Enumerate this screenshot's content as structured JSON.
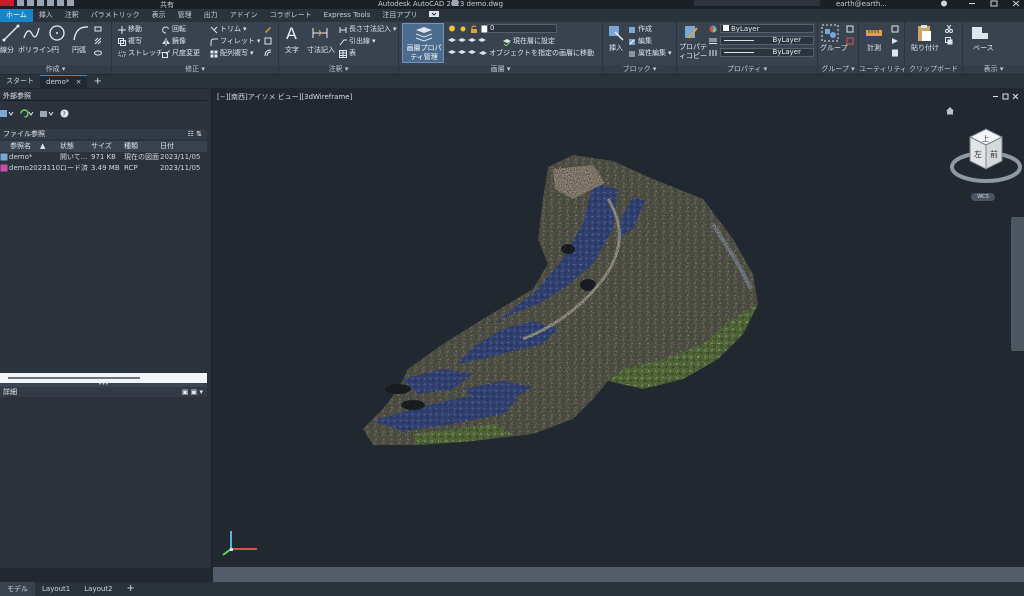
{
  "titlebar": {
    "title": "Autodesk AutoCAD 2023    demo.dwg",
    "share": "共有",
    "user": "earth@earth..."
  },
  "ribbon_tabs": [
    "ホーム",
    "挿入",
    "注釈",
    "パラメトリック",
    "表示",
    "管理",
    "出力",
    "アドイン",
    "コラボレート",
    "Express Tools",
    "注目アプリ"
  ],
  "panels": {
    "draw": {
      "title": "作成 ▾",
      "line": "線分",
      "polyline": "ポリライン",
      "circle": "円",
      "arc": "円弧"
    },
    "modify": {
      "title": "修正 ▾",
      "move": "移動",
      "rotate": "回転",
      "trim": "トリム",
      "copy": "複写",
      "mirror": "鏡像",
      "fillet": "フィレット",
      "stretch": "ストレッチ",
      "scale": "尺度変更",
      "array": "配列複写"
    },
    "annotation": {
      "title": "注釈 ▾",
      "text": "文字",
      "dimension": "寸法記入",
      "linear": "長さ寸法記入",
      "leader": "引出線",
      "table": "表"
    },
    "layers": {
      "title": "画層 ▾",
      "properties": "画層プロパティ管理",
      "layer_value": "0",
      "set_current": "現在層に設定",
      "match_layer": "オブジェクトを指定の画層に移動"
    },
    "block": {
      "title": "ブロック ▾",
      "insert": "挿入",
      "create": "作成",
      "edit": "編集",
      "attr_edit": "属性編集"
    },
    "properties": {
      "title": "プロパティ ▾",
      "match": "プロパティコピー",
      "color": "ByLayer",
      "linetype": "ByLayer",
      "lineweight": "ByLayer"
    },
    "groups": {
      "title": "グループ ▾",
      "group": "グループ"
    },
    "utilities": {
      "title": "ユーティリティ ▾",
      "measure": "計測"
    },
    "clipboard": {
      "title": "クリップボード",
      "paste": "貼り付け"
    },
    "view": {
      "title": "表示 ▾",
      "base": "ベース"
    }
  },
  "doc_tabs": [
    "スタート",
    "demo*"
  ],
  "palette": {
    "title": "外部参照",
    "file_refs": "ファイル参照",
    "columns": [
      "参照名",
      "状態",
      "サイズ",
      "種類",
      "日付"
    ],
    "rows": [
      {
        "name": "demo*",
        "status": "開いて...",
        "size": "971 KB",
        "type": "現在の図面",
        "date": "2023/11/05"
      },
      {
        "name": "demo20231104",
        "status": "ロード済",
        "size": "3.49 MB",
        "type": "RCP",
        "date": "2023/11/05"
      }
    ],
    "details": "詳細"
  },
  "viewport": {
    "label": "[−][南西]アイソメ ビュー][3dWireframe]",
    "cube_top": "上",
    "cube_left": "左",
    "cube_front": "前",
    "wcs": "WCS"
  },
  "layout_tabs": [
    "モデル",
    "Layout1",
    "Layout2"
  ],
  "colors": {
    "accent": "#1486c9",
    "background": "#212830",
    "ribbon": "#39434f"
  }
}
